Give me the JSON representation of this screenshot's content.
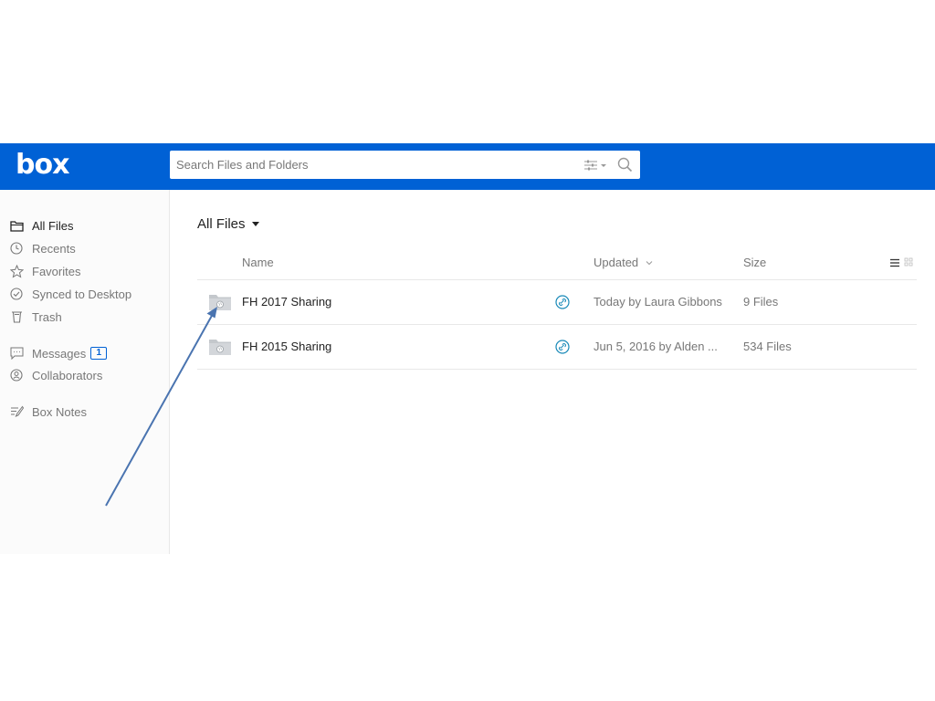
{
  "app": {
    "logo": "box"
  },
  "search": {
    "placeholder": "Search Files and Folders"
  },
  "sidebar": {
    "items": [
      {
        "label": "All Files",
        "icon": "folder-icon"
      },
      {
        "label": "Recents",
        "icon": "clock-icon"
      },
      {
        "label": "Favorites",
        "icon": "star-icon"
      },
      {
        "label": "Synced to Desktop",
        "icon": "check-circle-icon"
      },
      {
        "label": "Trash",
        "icon": "trash-icon"
      },
      {
        "label": "Messages",
        "icon": "speech-bubble-icon",
        "badge": "1"
      },
      {
        "label": "Collaborators",
        "icon": "person-icon"
      },
      {
        "label": "Box Notes",
        "icon": "notes-icon"
      }
    ]
  },
  "main": {
    "heading": "All Files",
    "columns": {
      "name": "Name",
      "updated": "Updated",
      "size": "Size"
    },
    "rows": [
      {
        "name": "FH 2017 Sharing",
        "updated": "Today by Laura Gibbons",
        "size": "9 Files"
      },
      {
        "name": "FH 2015 Sharing",
        "updated": "Jun 5, 2016 by Alden ...",
        "size": "534 Files"
      }
    ]
  },
  "colors": {
    "brand": "#0061d5",
    "annotation_arrow": "#4a74b0"
  }
}
